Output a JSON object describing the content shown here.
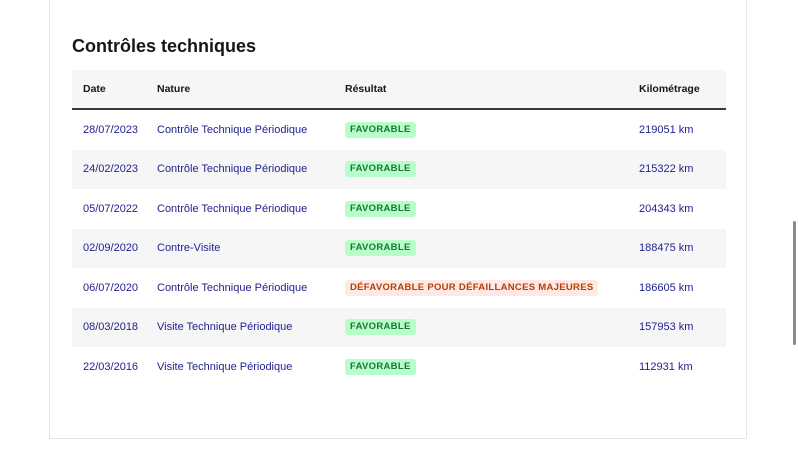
{
  "section": {
    "title": "Contrôles techniques"
  },
  "table": {
    "headers": {
      "date": "Date",
      "nature": "Nature",
      "result": "Résultat",
      "mileage": "Kilométrage"
    },
    "rows": [
      {
        "date": "28/07/2023",
        "nature": "Contrôle Technique Périodique",
        "result": "FAVORABLE",
        "status": "ok",
        "mileage": "219051 km"
      },
      {
        "date": "24/02/2023",
        "nature": "Contrôle Technique Périodique",
        "result": "FAVORABLE",
        "status": "ok",
        "mileage": "215322 km"
      },
      {
        "date": "05/07/2022",
        "nature": "Contrôle Technique Périodique",
        "result": "FAVORABLE",
        "status": "ok",
        "mileage": "204343 km"
      },
      {
        "date": "02/09/2020",
        "nature": "Contre-Visite",
        "result": "FAVORABLE",
        "status": "ok",
        "mileage": "188475 km"
      },
      {
        "date": "06/07/2020",
        "nature": "Contrôle Technique Périodique",
        "result": "DÉFAVORABLE POUR DÉFAILLANCES MAJEURES",
        "status": "ko",
        "mileage": "186605 km"
      },
      {
        "date": "08/03/2018",
        "nature": "Visite Technique Périodique",
        "result": "FAVORABLE",
        "status": "ok",
        "mileage": "157953 km"
      },
      {
        "date": "22/03/2016",
        "nature": "Visite Technique Périodique",
        "result": "FAVORABLE",
        "status": "ok",
        "mileage": "112931 km"
      }
    ]
  },
  "colors": {
    "favorable_bg": "#b8fec9",
    "favorable_text": "#18753c",
    "unfavorable_bg": "#ffe9e6",
    "unfavorable_text": "#b34000",
    "link_text": "#1f1f8f"
  }
}
